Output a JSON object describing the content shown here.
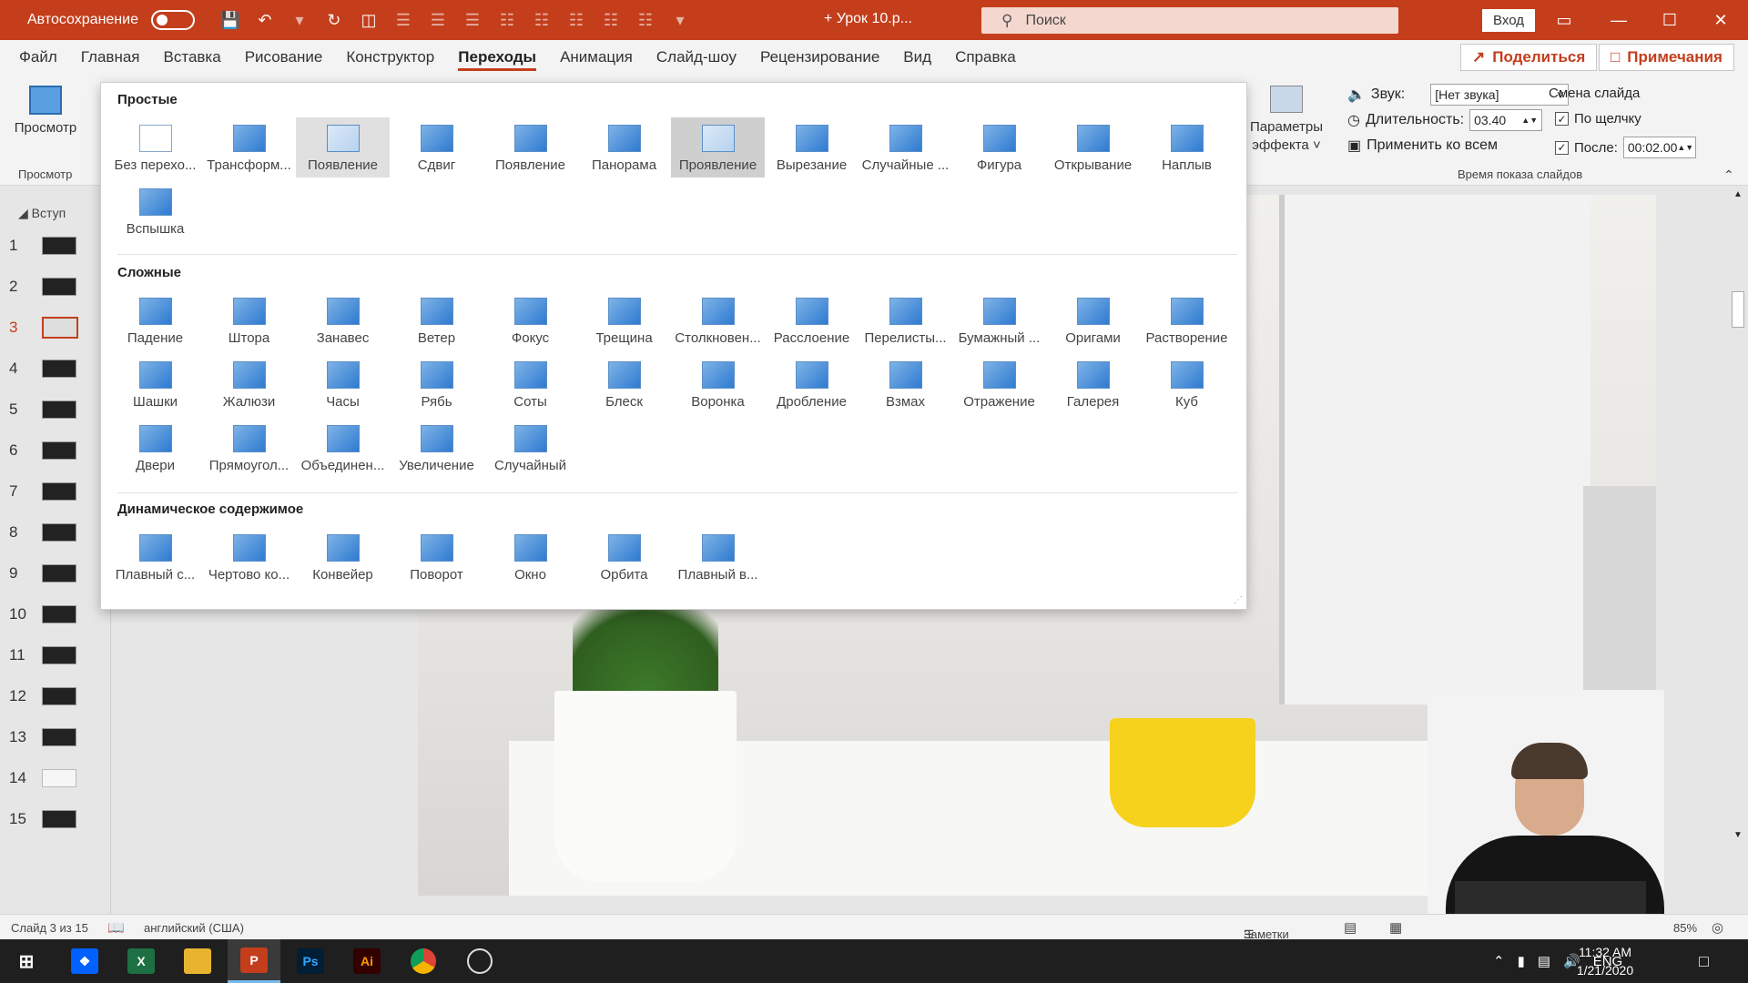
{
  "titlebar": {
    "autosave_label": "Автосохранение",
    "doc_title": "+ Урок 10.р...",
    "search_placeholder": "Поиск",
    "signin_label": "Вход"
  },
  "menu": {
    "tabs": [
      "Файл",
      "Главная",
      "Вставка",
      "Рисование",
      "Конструктор",
      "Переходы",
      "Анимация",
      "Слайд-шоу",
      "Рецензирование",
      "Вид",
      "Справка"
    ],
    "active_tab": "Переходы",
    "share_label": "Поделиться",
    "comments_label": "Примечания"
  },
  "ribbon": {
    "preview_label": "Просмотр",
    "preview_group": "Просмотр",
    "effect_label_1": "Параметры",
    "effect_label_2": "эффекта",
    "sound_label": "Звук:",
    "sound_value": "[Нет звука]",
    "duration_label": "Длительность:",
    "duration_value": "03.40",
    "apply_all_label": "Применить ко всем",
    "advance_title": "Смена слайда",
    "on_click_label": "По щелчку",
    "after_label": "После:",
    "after_value": "00:02.00",
    "timing_group": "Время показа слайдов"
  },
  "gallery": {
    "simple_title": "Простые",
    "complex_title": "Сложные",
    "dynamic_title": "Динамическое содержимое",
    "simple": [
      "Без перехо...",
      "Трансформ...",
      "Появление",
      "Сдвиг",
      "Появление",
      "Панорама",
      "Проявление",
      "Вырезание",
      "Случайные ...",
      "Фигура",
      "Открывание",
      "Наплыв",
      "Вспышка"
    ],
    "complex": [
      "Падение",
      "Штора",
      "Занавес",
      "Ветер",
      "Фокус",
      "Трещина",
      "Столкновен...",
      "Расслоение",
      "Перелисты...",
      "Бумажный ...",
      "Оригами",
      "Растворение",
      "Шашки",
      "Жалюзи",
      "Часы",
      "Рябь",
      "Соты",
      "Блеск",
      "Воронка",
      "Дробление",
      "Взмах",
      "Отражение",
      "Галерея",
      "Куб",
      "Двери",
      "Прямоугол...",
      "Объединен...",
      "Увеличение",
      "Случайный"
    ],
    "dynamic": [
      "Плавный с...",
      "Чертово ко...",
      "Конвейер",
      "Поворот",
      "Окно",
      "Орбита",
      "Плавный в..."
    ]
  },
  "slides_panel": {
    "section_label": "Вступ",
    "numbers": [
      "1",
      "2",
      "3",
      "4",
      "5",
      "6",
      "7",
      "8",
      "9",
      "10",
      "11",
      "12",
      "13",
      "14",
      "15"
    ],
    "current": "3"
  },
  "status": {
    "slide_info": "Слайд 3 из 15",
    "language": "английский (США)",
    "notes_label": "Заметки",
    "zoom": "85%"
  },
  "taskbar": {
    "lang": "ENG",
    "time": "11:32 AM",
    "date": "1/21/2020",
    "apps": [
      "Dropbox",
      "Excel",
      "Проводник",
      "PowerPoint",
      "Ps",
      "Ai",
      "Chrome",
      "OBS"
    ]
  },
  "colors": {
    "accent": "#c43e1c",
    "ribbon_bg": "#f3f3f3",
    "taskbar_bg": "#1f1f1f"
  }
}
